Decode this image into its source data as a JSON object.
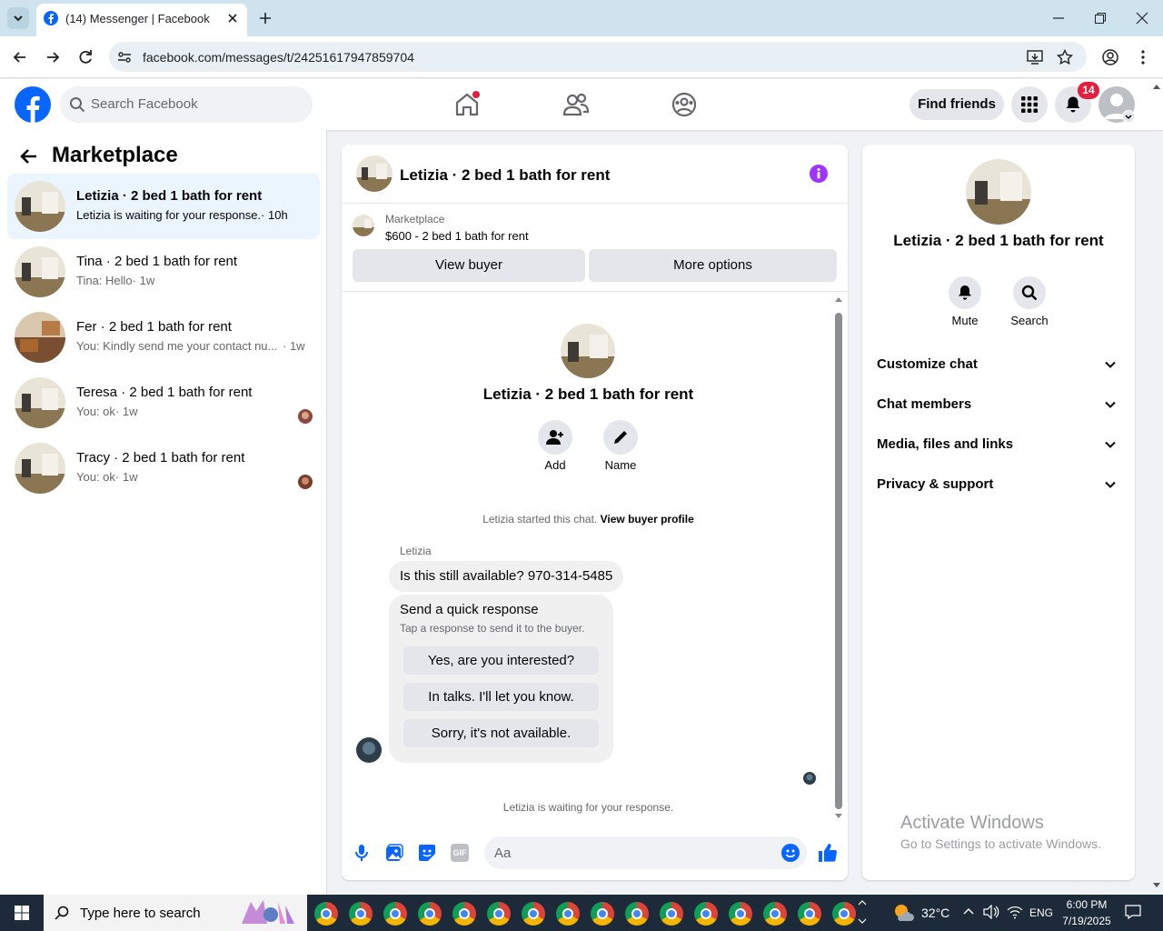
{
  "browser": {
    "tab_title": "(14) Messenger | Facebook",
    "url": "facebook.com/messages/t/24251617947859704"
  },
  "fb": {
    "search_placeholder": "Search Facebook",
    "find_friends": "Find friends",
    "notif_count": "14"
  },
  "sidebar": {
    "title": "Marketplace",
    "chats": [
      {
        "name": "Letizia · 2 bed 1 bath for rent",
        "sub": "Letizia is waiting for your response.",
        "time": "· 10h",
        "bold": true
      },
      {
        "name": "Tina · 2 bed 1 bath for rent",
        "sub": "Tina: Hello",
        "time": "· 1w"
      },
      {
        "name": "Fer · 2 bed 1 bath for rent",
        "sub": "You: Kindly send me your contact nu...",
        "time": "· 1w"
      },
      {
        "name": "Teresa · 2 bed 1 bath for rent",
        "sub": "You: ok",
        "time": "· 1w"
      },
      {
        "name": "Tracy · 2 bed 1 bath for rent",
        "sub": "You: ok",
        "time": "· 1w"
      }
    ]
  },
  "chat": {
    "header_title": "Letizia · 2 bed 1 bath for rent",
    "listing_source": "Marketplace",
    "listing_desc": "$600 - 2 bed 1 bath for rent",
    "view_buyer": "View buyer",
    "more_options": "More options",
    "profile_name": "Letizia · 2 bed 1 bath for rent",
    "add_label": "Add",
    "name_label": "Name",
    "started_text": "Letizia started this chat.",
    "view_profile_link": "View buyer profile",
    "sender": "Letizia",
    "message": "Is this still available? 970-314-5485",
    "quick_title": "Send a quick response",
    "quick_sub": "Tap a response to send it to the buyer.",
    "quick_replies": [
      "Yes, are you interested?",
      "In talks. I'll let you know.",
      "Sorry, it's not available."
    ],
    "waiting_text": "Letizia is waiting for your response.",
    "composer_placeholder": "Aa"
  },
  "details": {
    "name": "Letizia · 2 bed 1 bath for rent",
    "mute": "Mute",
    "search": "Search",
    "sections": [
      "Customize chat",
      "Chat members",
      "Media, files and links",
      "Privacy & support"
    ]
  },
  "watermark": {
    "line1": "Activate Windows",
    "line2": "Go to Settings to activate Windows."
  },
  "taskbar": {
    "search_placeholder": "Type here to search",
    "temp": "32°C",
    "lang": "ENG",
    "time": "6:00 PM",
    "date": "7/19/2025"
  },
  "colors": {
    "fb_blue": "#0866ff",
    "purple": "#a033ff",
    "badge_red": "#e41e3f"
  }
}
